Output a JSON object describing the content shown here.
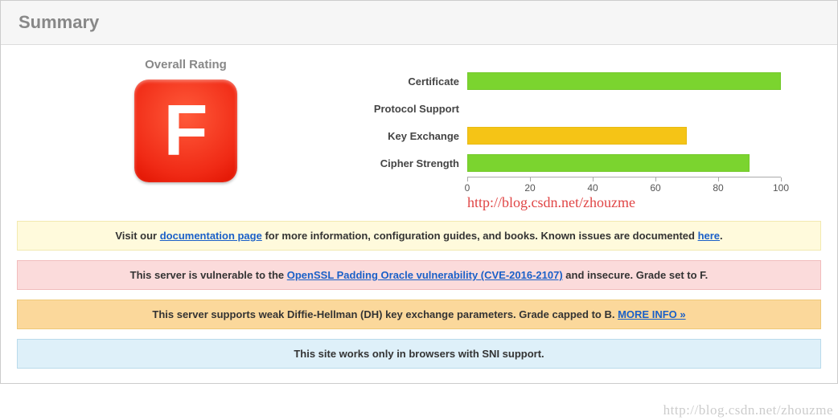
{
  "header": {
    "title": "Summary"
  },
  "rating": {
    "label": "Overall Rating",
    "grade": "F"
  },
  "chart_data": {
    "type": "bar",
    "categories": [
      "Certificate",
      "Protocol Support",
      "Key Exchange",
      "Cipher Strength"
    ],
    "values": [
      100,
      0,
      70,
      90
    ],
    "colors": [
      "#7bd42f",
      "#7bd42f",
      "#f5c416",
      "#7bd42f"
    ],
    "xlim": [
      0,
      100
    ],
    "ticks": [
      0,
      20,
      40,
      60,
      80,
      100
    ],
    "xlabel": "",
    "ylabel": "",
    "title": ""
  },
  "watermark_inline": "http://blog.csdn.net/zhouzme",
  "watermark_corner": "http://blog.csdn.net/zhouzme",
  "notices": [
    {
      "style": "yellow",
      "parts": [
        {
          "text": "Visit our "
        },
        {
          "text": "documentation page",
          "link": true
        },
        {
          "text": " for more information, configuration guides, and books. Known issues are documented "
        },
        {
          "text": "here",
          "link": true
        },
        {
          "text": "."
        }
      ]
    },
    {
      "style": "pink",
      "parts": [
        {
          "text": "This server is vulnerable to the "
        },
        {
          "text": "OpenSSL Padding Oracle vulnerability (CVE-2016-2107)",
          "link": true
        },
        {
          "text": " and insecure. Grade set to F."
        }
      ]
    },
    {
      "style": "orange",
      "parts": [
        {
          "text": "This server supports weak Diffie-Hellman (DH) key exchange parameters. Grade capped to B.   "
        },
        {
          "text": "MORE INFO »",
          "link": true
        }
      ]
    },
    {
      "style": "blue",
      "parts": [
        {
          "text": "This site works only in browsers with SNI support."
        }
      ]
    }
  ]
}
